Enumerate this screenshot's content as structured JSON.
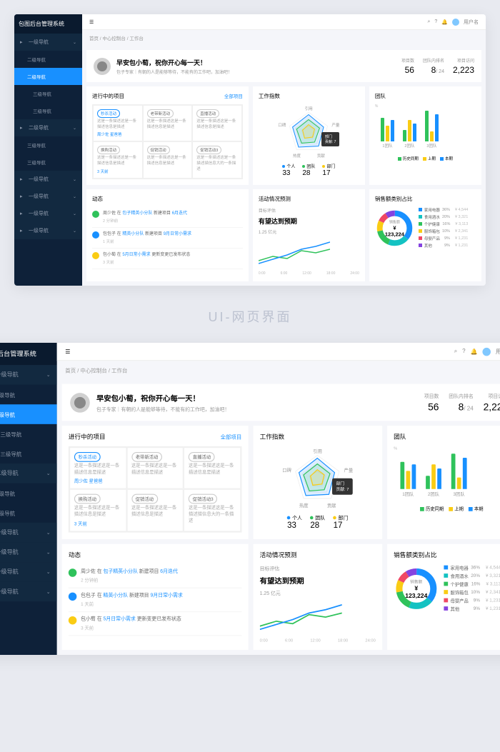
{
  "system_name": "包图后台管理系统",
  "sidebar": {
    "items": [
      {
        "label": "一级导航",
        "type": "top",
        "icon": "home"
      },
      {
        "label": "二级导航",
        "type": "sub"
      },
      {
        "label": "二级导航",
        "type": "sub",
        "active": true
      },
      {
        "label": "三级导航",
        "type": "sub2"
      },
      {
        "label": "三级导航",
        "type": "sub2"
      },
      {
        "label": "二级导航",
        "type": "top",
        "icon": "layers"
      },
      {
        "label": "三级导航",
        "type": "sub"
      },
      {
        "label": "三级导航",
        "type": "sub"
      },
      {
        "label": "一级导航",
        "type": "top",
        "icon": "list"
      },
      {
        "label": "一级导航",
        "type": "top",
        "icon": "grid"
      },
      {
        "label": "一级导航",
        "type": "top",
        "icon": "user"
      },
      {
        "label": "一级导航",
        "type": "top",
        "icon": "cloud"
      }
    ]
  },
  "topbar": {
    "username": "用户名"
  },
  "crumbs": "首页 / 中心控制台 / 工作台",
  "greeting": {
    "title": "早安包小萄，祝你开心每一天！",
    "subtitle": "包子专家｜有朝的人是能够等待，不能有的工作吧，加油吧！"
  },
  "stats": [
    {
      "label": "项目数",
      "value": "56"
    },
    {
      "label": "团队内排名",
      "value": "8",
      "suffix": "/ 24"
    },
    {
      "label": "项目访问",
      "value": "2,223"
    }
  ],
  "projects": {
    "title": "进行中的项目",
    "link": "全部项目",
    "items": [
      {
        "tag": "秒杀活动",
        "desc": "这是一条描述这是一条描述信息是描述",
        "link": "周少佐 星爸爸"
      },
      {
        "tag": "老带新活动",
        "plain": true,
        "desc": "这是一条描述这是一条描述信息是描述"
      },
      {
        "tag": "直播活动",
        "plain": true,
        "desc": "这是一条描述这是一条描述信息是描述"
      },
      {
        "tag": "换购活动",
        "plain": true,
        "desc": "这是一条描述这是一条描述信息是描述",
        "link": "3 天前"
      },
      {
        "tag": "促销活动",
        "plain": true,
        "desc": "这是一条描述这是一条描述信息是描述"
      },
      {
        "tag": "促销活动3",
        "plain": true,
        "desc": "这是一条描述这是一条描述描信息大的一条描述"
      }
    ]
  },
  "workindex": {
    "title": "工作指数",
    "axes": [
      "引用",
      "口碑",
      "产量",
      "热度",
      "贡献"
    ],
    "stats": [
      {
        "label": "个人",
        "value": "33",
        "color": "#1890ff"
      },
      {
        "label": "团队",
        "value": "28",
        "color": "#2fc25b"
      },
      {
        "label": "部门",
        "value": "17",
        "color": "#facc14"
      }
    ],
    "tooltip": {
      "title": "部门",
      "line": "贡献: 7"
    }
  },
  "team": {
    "title": "团队",
    "chart_data": {
      "type": "bar",
      "categories": [
        "1团队",
        "2团队",
        "3团队"
      ],
      "series": [
        {
          "name": "历史同期",
          "color": "#2fc25b",
          "values": [
            60,
            30,
            78
          ]
        },
        {
          "name": "上期",
          "color": "#facc14",
          "values": [
            40,
            55,
            25
          ]
        },
        {
          "name": "本期",
          "color": "#1890ff",
          "values": [
            55,
            45,
            70
          ]
        }
      ],
      "ylim": [
        0,
        100
      ],
      "ylabel": "%"
    }
  },
  "activity": {
    "title": "动态",
    "items": [
      {
        "color": "#2fc25b",
        "text": "周少佐 在 包子精英小分队 新建项目 6月迭代",
        "time": "2 分钟前"
      },
      {
        "color": "#1890ff",
        "text": "包包子 在 精英小分队 新建项目 9月日常小需求",
        "time": "1 天前"
      },
      {
        "color": "#facc14",
        "text": "包小萄 在 5月日常小需求 更新变更已发布状态",
        "time": "3 天前"
      }
    ]
  },
  "forecast": {
    "title": "活动情况预测",
    "subtitle": "目标评估",
    "big": "有望达到预期",
    "amount": "1.25 亿元",
    "chart_data": {
      "type": "line",
      "x": [
        "0:00",
        "6:00",
        "12:00",
        "18:00",
        "24:00"
      ],
      "series": [
        {
          "name": "a",
          "color": "#2fc25b",
          "values": [
            10,
            18,
            14,
            28,
            24
          ]
        },
        {
          "name": "b",
          "color": "#1890ff",
          "values": [
            6,
            12,
            20,
            32,
            40
          ]
        }
      ]
    }
  },
  "donut": {
    "title": "销售额类别占比",
    "center_label": "销售额",
    "center_value": "¥ 123,224",
    "chart_data": {
      "type": "pie",
      "items": [
        {
          "label": "家用电器",
          "value": 36,
          "pct": "36%",
          "amt": "¥ 4,544",
          "color": "#1890ff"
        },
        {
          "label": "食用酒水",
          "value": 20,
          "pct": "20%",
          "amt": "¥ 3,321",
          "color": "#13c2c2"
        },
        {
          "label": "个护健康",
          "value": 16,
          "pct": "16%",
          "amt": "¥ 3,113",
          "color": "#2fc25b"
        },
        {
          "label": "服饰箱包",
          "value": 10,
          "pct": "10%",
          "amt": "¥ 2,341",
          "color": "#facc14"
        },
        {
          "label": "母婴产品",
          "value": 9,
          "pct": "9%",
          "amt": "¥ 1,231",
          "color": "#f04864"
        },
        {
          "label": "其他",
          "value": 9,
          "pct": "9%",
          "amt": "¥ 1,231",
          "color": "#8543e0"
        }
      ]
    }
  },
  "between_title": "UI-网页界面"
}
